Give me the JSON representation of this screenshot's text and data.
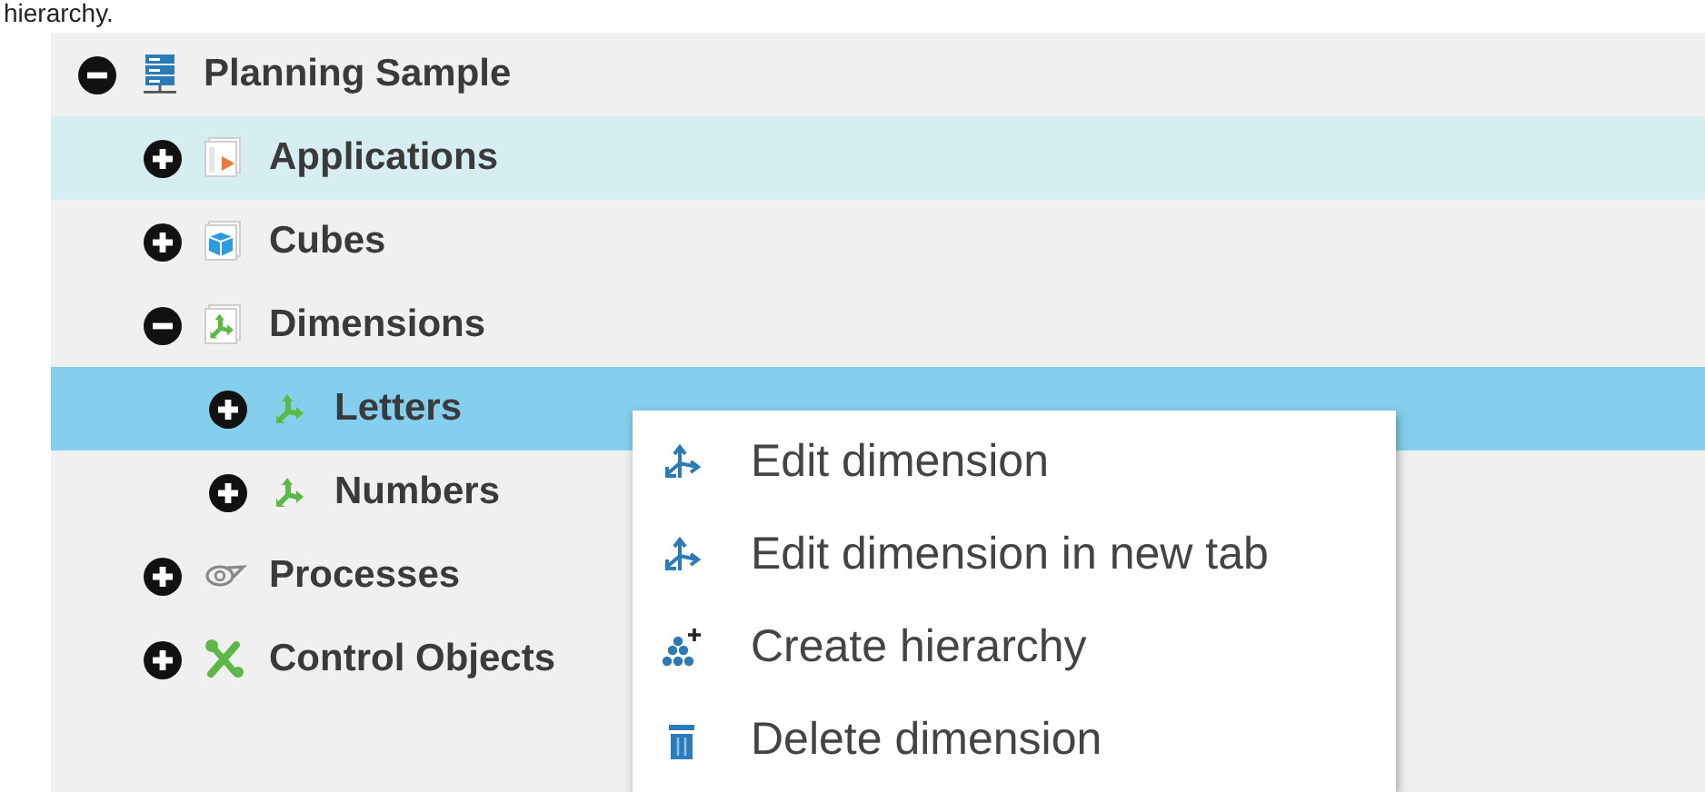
{
  "caption": "hierarchy.",
  "tree": [
    {
      "label": "Planning Sample",
      "kind": "server",
      "expanded": true,
      "selected": false,
      "hovered": false,
      "children": [
        {
          "label": "Applications",
          "kind": "applications",
          "expanded": false,
          "selected": false,
          "hovered": true
        },
        {
          "label": "Cubes",
          "kind": "cubes",
          "expanded": false,
          "selected": false,
          "hovered": false
        },
        {
          "label": "Dimensions",
          "kind": "dimensions",
          "expanded": true,
          "selected": false,
          "hovered": false,
          "children": [
            {
              "label": "Letters",
              "kind": "dimension",
              "expanded": false,
              "selected": true,
              "hovered": false
            },
            {
              "label": "Numbers",
              "kind": "dimension",
              "expanded": false,
              "selected": false,
              "hovered": false
            }
          ]
        },
        {
          "label": "Processes",
          "kind": "processes",
          "expanded": false,
          "selected": false,
          "hovered": false
        },
        {
          "label": "Control Objects",
          "kind": "control",
          "expanded": false,
          "selected": false,
          "hovered": false
        }
      ]
    }
  ],
  "context_menu": [
    {
      "label": "Edit dimension",
      "kind": "edit"
    },
    {
      "label": "Edit dimension in new tab",
      "kind": "edit"
    },
    {
      "label": "Create hierarchy",
      "kind": "hierarchy"
    },
    {
      "label": "Delete dimension",
      "kind": "delete"
    }
  ]
}
